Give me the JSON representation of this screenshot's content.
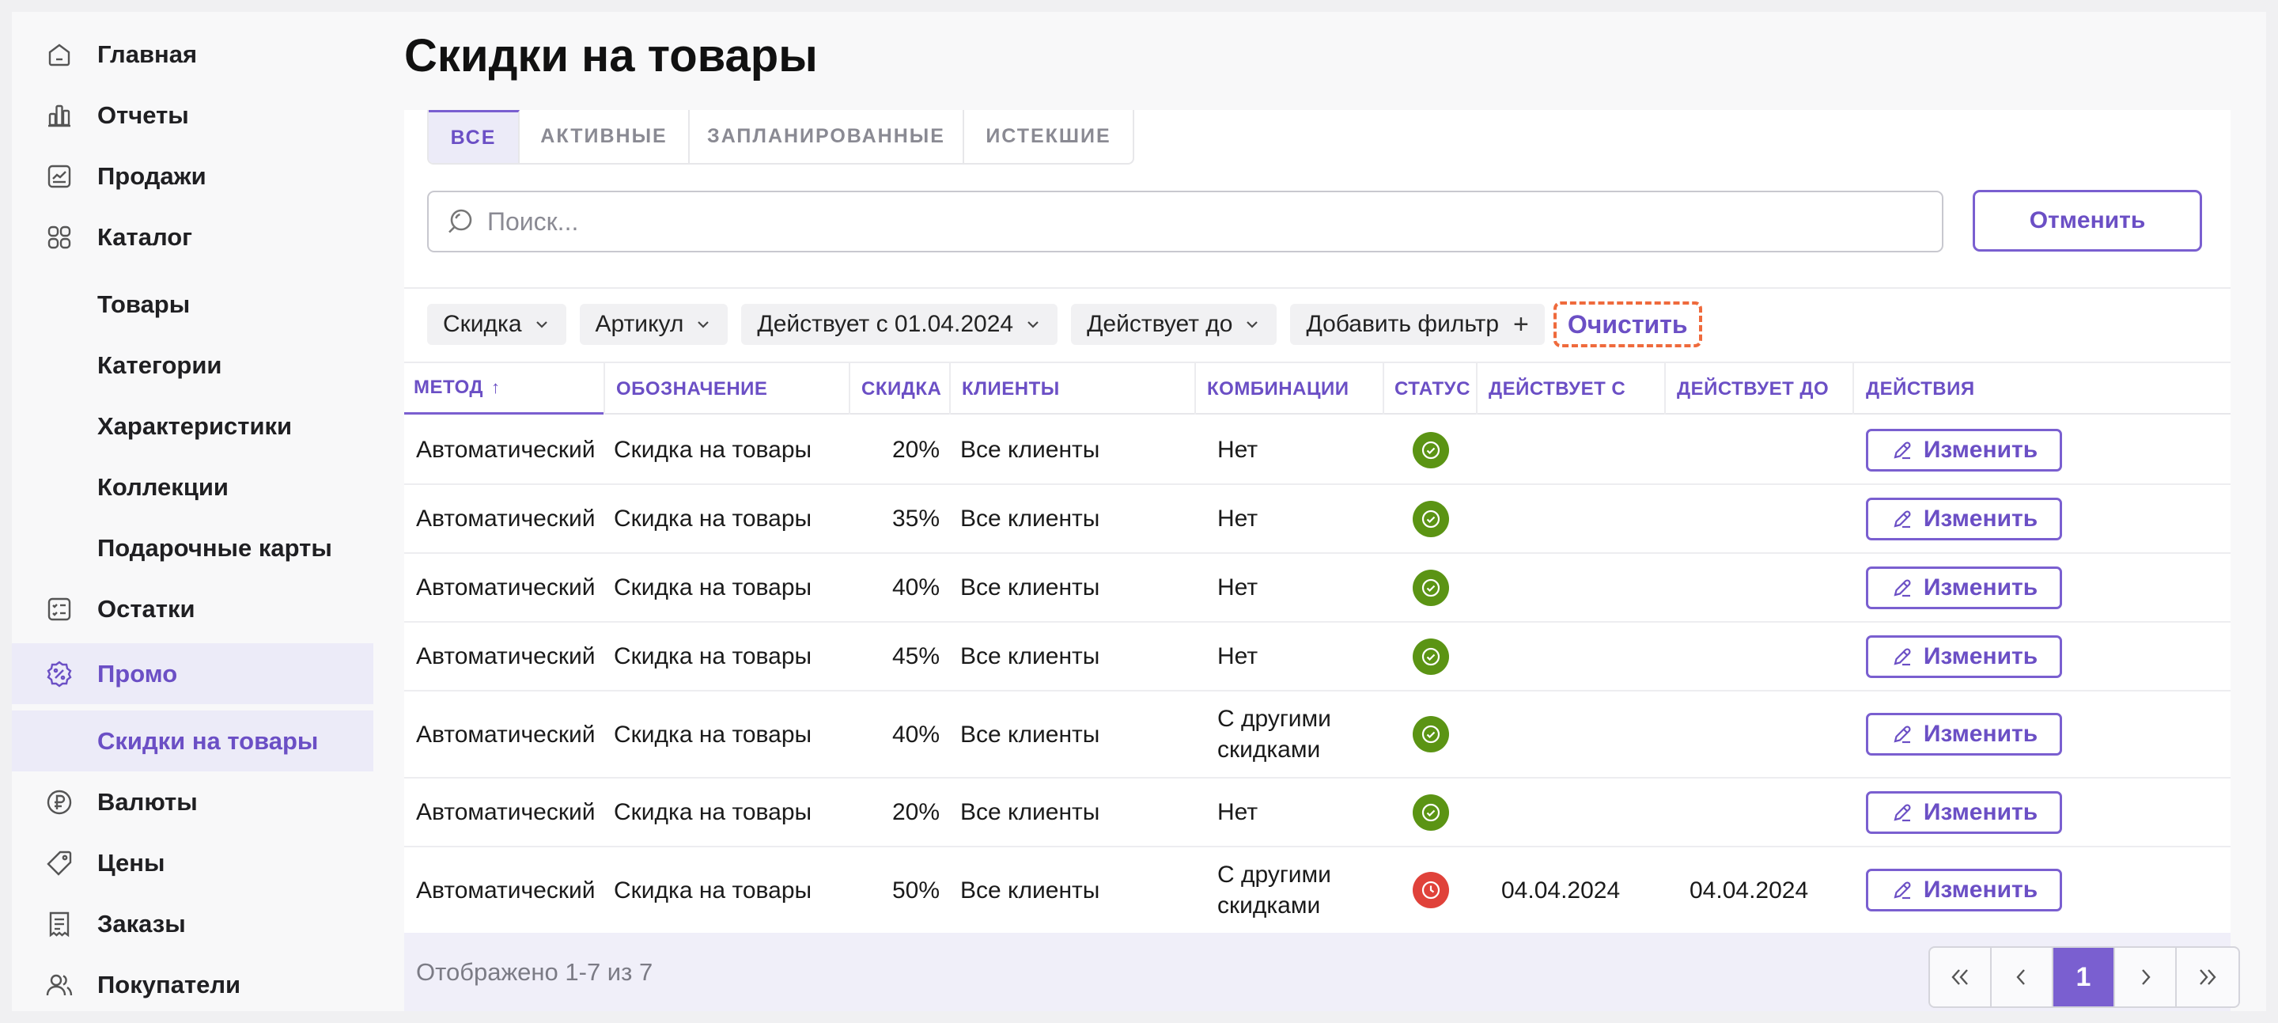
{
  "sidebar": {
    "items": [
      {
        "label": "Главная",
        "icon": "home-icon"
      },
      {
        "label": "Отчеты",
        "icon": "bar-chart-icon"
      },
      {
        "label": "Продажи",
        "icon": "sales-chart-icon"
      },
      {
        "label": "Каталог",
        "icon": "grid-icon"
      },
      {
        "label": "Товары"
      },
      {
        "label": "Категории"
      },
      {
        "label": "Характеристики"
      },
      {
        "label": "Коллекции"
      },
      {
        "label": "Подарочные карты"
      },
      {
        "label": "Остатки",
        "icon": "checklist-icon"
      },
      {
        "label": "Промо",
        "icon": "percent-badge-icon"
      },
      {
        "label": "Скидки на товары"
      },
      {
        "label": "Валюты",
        "icon": "ruble-icon"
      },
      {
        "label": "Цены",
        "icon": "price-tag-icon"
      },
      {
        "label": "Заказы",
        "icon": "receipt-icon"
      },
      {
        "label": "Покупатели",
        "icon": "users-icon"
      }
    ]
  },
  "page": {
    "title": "Скидки на товары"
  },
  "tabs": [
    {
      "label": "ВСЕ"
    },
    {
      "label": "АКТИВНЫЕ"
    },
    {
      "label": "ЗАПЛАНИРОВАННЫЕ"
    },
    {
      "label": "ИСТЕКШИЕ"
    }
  ],
  "search": {
    "placeholder": "Поиск...",
    "value": "",
    "cancel_label": "Отменить"
  },
  "filters": {
    "chips": [
      {
        "label": "Скидка"
      },
      {
        "label": "Артикул"
      },
      {
        "label": "Действует с 01.04.2024"
      },
      {
        "label": "Действует до"
      }
    ],
    "add_label": "Добавить фильтр",
    "add_symbol": "+",
    "clear_label": "Очистить"
  },
  "table": {
    "headers": {
      "method": "МЕТОД",
      "sort_indicator": "↑",
      "name": "ОБОЗНАЧЕНИЕ",
      "discount": "СКИДКА",
      "clients": "КЛИЕНТЫ",
      "combinations": "КОМБИНАЦИИ",
      "status": "СТАТУС",
      "from": "ДЕЙСТВУЕТ С",
      "to": "ДЕЙСТВУЕТ ДО",
      "actions": "ДЕЙСТВИЯ"
    },
    "edit_label": "Изменить",
    "rows": [
      {
        "method": "Автоматический",
        "name": "Скидка на товары",
        "discount": "20%",
        "clients": "Все клиенты",
        "comb1": "Нет",
        "comb2": "",
        "status": "active",
        "from": "",
        "to": ""
      },
      {
        "method": "Автоматический",
        "name": "Скидка на товары",
        "discount": "35%",
        "clients": "Все клиенты",
        "comb1": "Нет",
        "comb2": "",
        "status": "active",
        "from": "",
        "to": ""
      },
      {
        "method": "Автоматический",
        "name": "Скидка на товары",
        "discount": "40%",
        "clients": "Все клиенты",
        "comb1": "Нет",
        "comb2": "",
        "status": "active",
        "from": "",
        "to": ""
      },
      {
        "method": "Автоматический",
        "name": "Скидка на товары",
        "discount": "45%",
        "clients": "Все клиенты",
        "comb1": "Нет",
        "comb2": "",
        "status": "active",
        "from": "",
        "to": ""
      },
      {
        "method": "Автоматический",
        "name": "Скидка на товары",
        "discount": "40%",
        "clients": "Все клиенты",
        "comb1": "С другими",
        "comb2": "скидками",
        "status": "active",
        "from": "",
        "to": ""
      },
      {
        "method": "Автоматический",
        "name": "Скидка на товары",
        "discount": "20%",
        "clients": "Все клиенты",
        "comb1": "Нет",
        "comb2": "",
        "status": "active",
        "from": "",
        "to": ""
      },
      {
        "method": "Автоматический",
        "name": "Скидка на товары",
        "discount": "50%",
        "clients": "Все клиенты",
        "comb1": "С другими",
        "comb2": "скидками",
        "status": "expired",
        "from": "04.04.2024",
        "to": "04.04.2024"
      }
    ]
  },
  "footer": {
    "count_text": "Отображено 1-7 из 7",
    "pager": {
      "first": "«",
      "prev": "‹",
      "current": "1",
      "next": "›",
      "last": "»"
    }
  },
  "colors": {
    "accent": "#7a5fd0",
    "status_active": "#5b9414",
    "status_expired": "#e0423a",
    "clear_outline": "#ef6a3c"
  }
}
